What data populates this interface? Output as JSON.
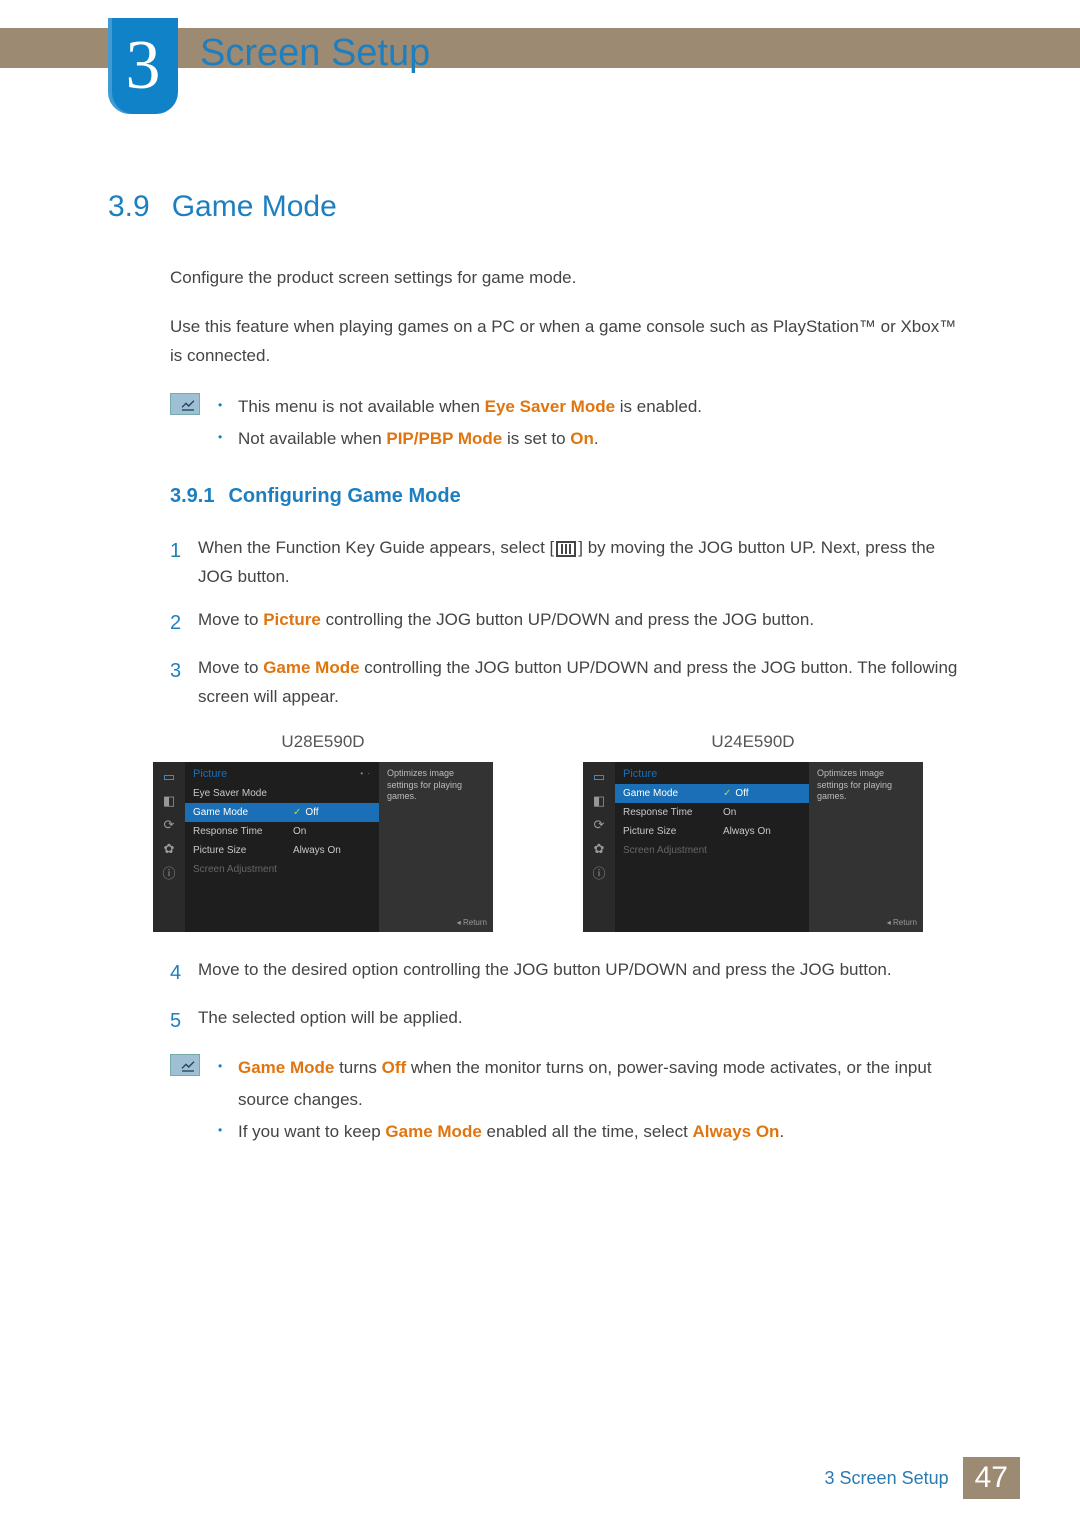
{
  "header": {
    "chapter_number": "3",
    "chapter_title": "Screen Setup"
  },
  "section": {
    "number": "3.9",
    "title": "Game Mode",
    "intro1": "Configure the product screen settings for game mode.",
    "intro2": "Use this feature when playing games on a PC or when a game console such as PlayStation™ or Xbox™ is connected."
  },
  "note1": {
    "item1_pre": "This menu is not available when ",
    "item1_hl": "Eye Saver Mode",
    "item1_post": " is enabled.",
    "item2_pre": "Not available when ",
    "item2_hl1": "PIP/PBP Mode",
    "item2_mid": " is set to ",
    "item2_hl2": "On",
    "item2_post": "."
  },
  "subsection": {
    "number": "3.9.1",
    "title": "Configuring Game Mode"
  },
  "steps": {
    "s1_a": "When the Function Key Guide appears, select [",
    "s1_b": "] by moving the JOG button UP. Next, press the JOG button.",
    "s2_a": "Move to ",
    "s2_hl": "Picture",
    "s2_b": " controlling the JOG button UP/DOWN and press the JOG button.",
    "s3_a": "Move to ",
    "s3_hl": "Game Mode",
    "s3_b": " controlling the JOG button UP/DOWN and press the JOG button. The following screen will appear.",
    "s4": "Move to the desired option controlling the JOG button UP/DOWN and press the JOG button.",
    "s5": "The selected option will be applied."
  },
  "osd": {
    "left_model": "U28E590D",
    "right_model": "U24E590D",
    "header": "Picture",
    "desc": "Optimizes image settings for playing games.",
    "return": "Return",
    "left_items": [
      {
        "label": "Eye Saver Mode",
        "value": "",
        "sel": false,
        "dim": false,
        "chk": false
      },
      {
        "label": "Game Mode",
        "value": "Off",
        "sel": true,
        "dim": false,
        "chk": true
      },
      {
        "label": "Response Time",
        "value": "On",
        "sel": false,
        "dim": false,
        "chk": false
      },
      {
        "label": "Picture Size",
        "value": "Always On",
        "sel": false,
        "dim": false,
        "chk": false
      },
      {
        "label": "Screen Adjustment",
        "value": "",
        "sel": false,
        "dim": true,
        "chk": false
      }
    ],
    "right_items": [
      {
        "label": "Game Mode",
        "value": "Off",
        "sel": true,
        "dim": false,
        "chk": true
      },
      {
        "label": "Response Time",
        "value": "On",
        "sel": false,
        "dim": false,
        "chk": false
      },
      {
        "label": "Picture Size",
        "value": "Always On",
        "sel": false,
        "dim": false,
        "chk": false
      },
      {
        "label": "Screen Adjustment",
        "value": "",
        "sel": false,
        "dim": true,
        "chk": false
      }
    ]
  },
  "note2": {
    "item1_hl": "Game Mode",
    "item1_mid": " turns ",
    "item1_hl2": "Off",
    "item1_post": " when the monitor turns on, power-saving mode activates, or the input source changes.",
    "item2_pre": "If you want to keep ",
    "item2_hl1": "Game Mode",
    "item2_mid": " enabled all the time, select ",
    "item2_hl2": "Always On",
    "item2_post": "."
  },
  "footer": {
    "label": "3 Screen Setup",
    "page": "47"
  }
}
